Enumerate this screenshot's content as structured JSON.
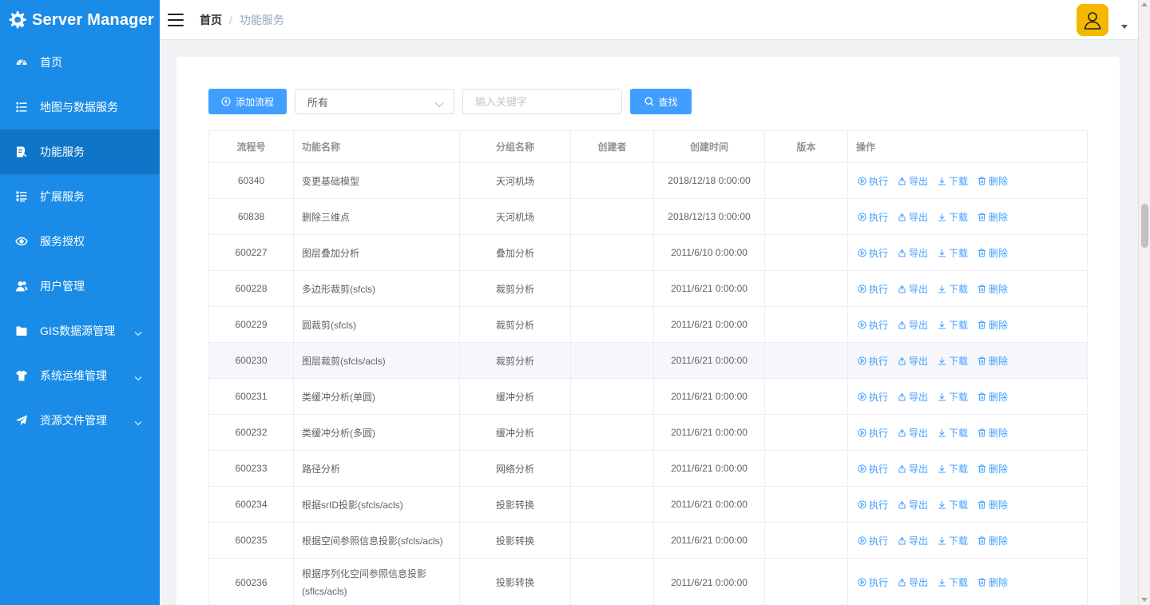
{
  "app": {
    "title": "Server Manager"
  },
  "sidebar": {
    "items": [
      {
        "label": "首页",
        "icon": "dashboard-icon"
      },
      {
        "label": "地图与数据服务",
        "icon": "list-icon"
      },
      {
        "label": "功能服务",
        "icon": "function-icon",
        "active": true
      },
      {
        "label": "扩展服务",
        "icon": "extend-icon"
      },
      {
        "label": "服务授权",
        "icon": "eye-icon"
      },
      {
        "label": "用户管理",
        "icon": "user-icon"
      },
      {
        "label": "GIS数据源管理",
        "icon": "folder-icon",
        "expandable": true
      },
      {
        "label": "系统运维管理",
        "icon": "shirt-icon",
        "expandable": true
      },
      {
        "label": "资源文件管理",
        "icon": "send-icon",
        "expandable": true
      }
    ]
  },
  "header": {
    "breadcrumb": {
      "home": "首页",
      "separator": "/",
      "current": "功能服务"
    }
  },
  "toolbar": {
    "add_label": "添加流程",
    "select_value": "所有",
    "search_placeholder": "输入关键字",
    "search_label": "查找"
  },
  "table": {
    "headers": [
      "流程号",
      "功能名称",
      "分组名称",
      "创建者",
      "创建时间",
      "版本",
      "操作"
    ],
    "ops": [
      "执行",
      "导出",
      "下载",
      "删除"
    ],
    "rows": [
      {
        "id": "60340",
        "name": "变更基础模型",
        "group": "天河机场",
        "creator": "",
        "time": "2018/12/18 0:00:00",
        "version": ""
      },
      {
        "id": "60838",
        "name": "删除三维点",
        "group": "天河机场",
        "creator": "",
        "time": "2018/12/13 0:00:00",
        "version": ""
      },
      {
        "id": "600227",
        "name": "图层叠加分析",
        "group": "叠加分析",
        "creator": "",
        "time": "2011/6/10 0:00:00",
        "version": ""
      },
      {
        "id": "600228",
        "name": "多边形裁剪(sfcls)",
        "group": "裁剪分析",
        "creator": "",
        "time": "2011/6/21 0:00:00",
        "version": ""
      },
      {
        "id": "600229",
        "name": "圆裁剪(sfcls)",
        "group": "裁剪分析",
        "creator": "",
        "time": "2011/6/21 0:00:00",
        "version": ""
      },
      {
        "id": "600230",
        "name": "图层裁剪(sfcls/acls)",
        "group": "裁剪分析",
        "creator": "",
        "time": "2011/6/21 0:00:00",
        "version": ""
      },
      {
        "id": "600231",
        "name": "类缓冲分析(单圆)",
        "group": "缓冲分析",
        "creator": "",
        "time": "2011/6/21 0:00:00",
        "version": ""
      },
      {
        "id": "600232",
        "name": "类缓冲分析(多圆)",
        "group": "缓冲分析",
        "creator": "",
        "time": "2011/6/21 0:00:00",
        "version": ""
      },
      {
        "id": "600233",
        "name": "路径分析",
        "group": "网络分析",
        "creator": "",
        "time": "2011/6/21 0:00:00",
        "version": ""
      },
      {
        "id": "600234",
        "name": "根据srID投影(sfcls/acls)",
        "group": "投影转换",
        "creator": "",
        "time": "2011/6/21 0:00:00",
        "version": ""
      },
      {
        "id": "600235",
        "name": "根据空间参照信息投影(sfcls/acls)",
        "group": "投影转换",
        "creator": "",
        "time": "2011/6/21 0:00:00",
        "version": ""
      },
      {
        "id": "600236",
        "name": "根据序列化空间参照信息投影(sflcs/acls)",
        "group": "投影转换",
        "creator": "",
        "time": "2011/6/21 0:00:00",
        "version": ""
      }
    ]
  },
  "colors": {
    "sidebar": "#1a8ce8",
    "sidebar_active": "#0f75c7",
    "primary": "#409eff",
    "avatar": "#f5b800"
  }
}
